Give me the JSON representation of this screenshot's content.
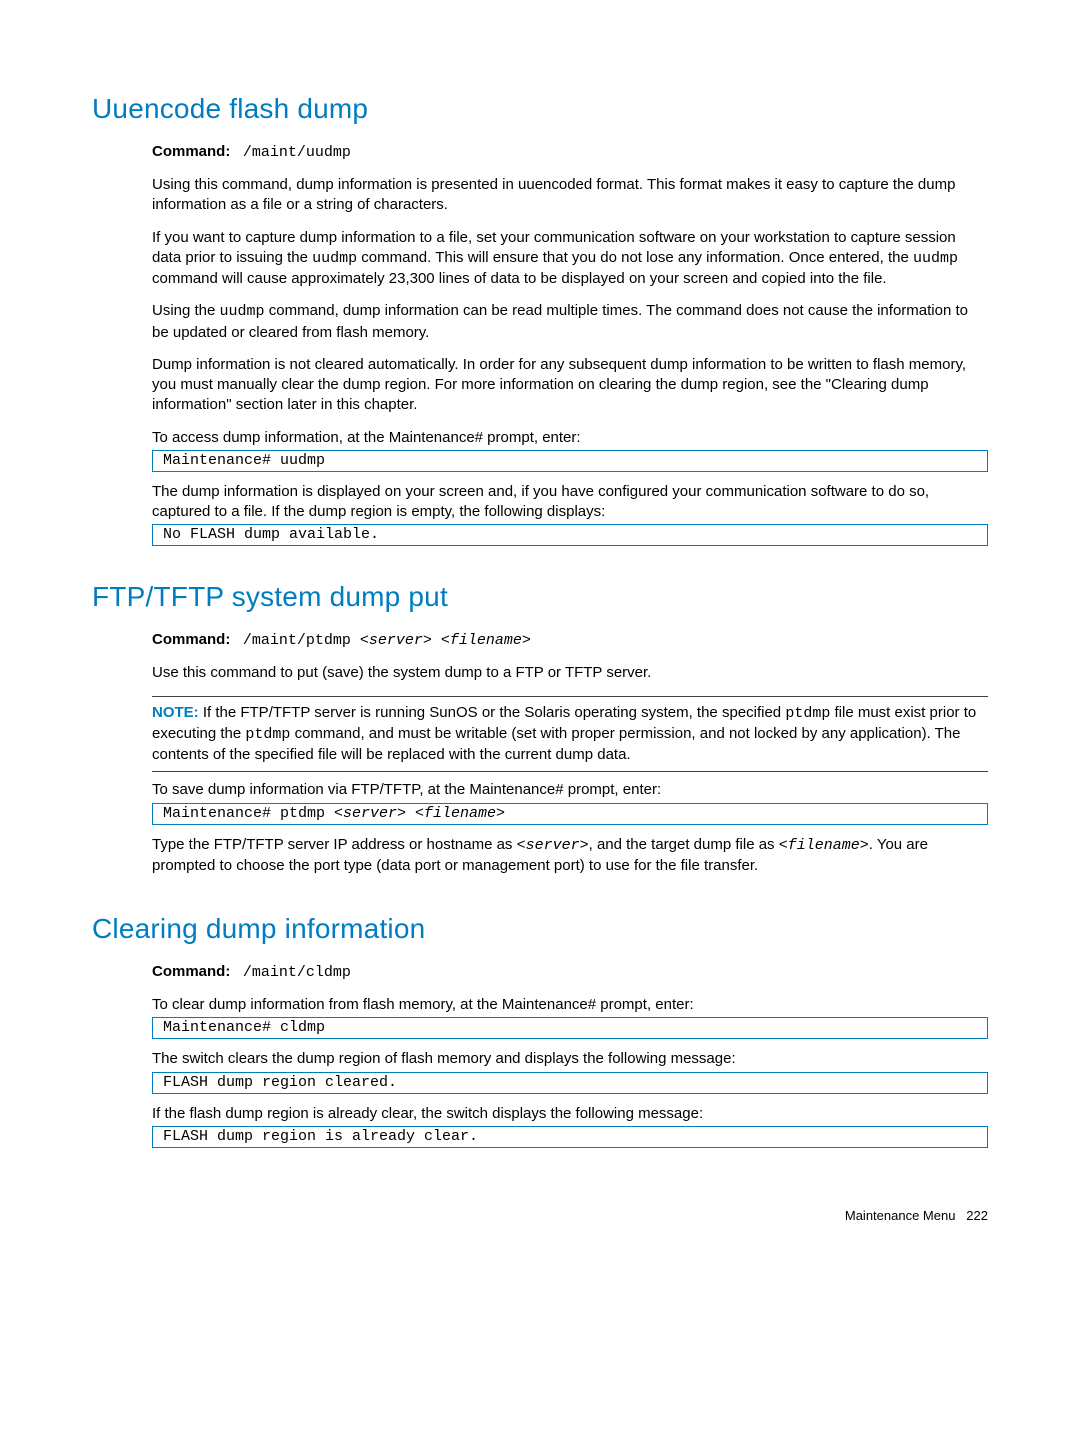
{
  "section1": {
    "heading": "Uuencode flash dump",
    "commandLabel": "Command:",
    "commandValue": "/maint/uudmp",
    "p1": "Using this command, dump information is presented in uuencoded format. This format makes it easy to capture the dump information as a file or a string of characters.",
    "p2_a": "If you want to capture dump information to a file, set your communication software on your workstation to capture session data prior to issuing the ",
    "p2_code1": "uudmp",
    "p2_b": " command. This will ensure that you do not lose any information. Once entered, the ",
    "p2_code2": "uudmp",
    "p2_c": " command will cause approximately 23,300 lines of data to be displayed on your screen and copied into the file.",
    "p3_a": "Using the ",
    "p3_code": "uudmp",
    "p3_b": " command, dump information can be read multiple times. The command does not cause the information to be updated or cleared from flash memory.",
    "p4": "Dump information is not cleared automatically. In order for any subsequent dump information to be written to flash memory, you must manually clear the dump region. For more information on clearing the dump region, see the \"Clearing dump information\" section later in this chapter.",
    "p5": "To access dump information, at the Maintenance# prompt, enter:",
    "code1": "Maintenance# uudmp",
    "p6": "The dump information is displayed on your screen and, if you have configured your communication software to do so, captured to a file. If the dump region is empty, the following displays:",
    "code2": "No FLASH dump available."
  },
  "section2": {
    "heading": "FTP/TFTP system dump put",
    "commandLabel": "Command:",
    "commandValue_a": "/maint/ptdmp ",
    "commandValue_b": "<server> <filename>",
    "p1": "Use this command to put (save) the system dump to a FTP or TFTP server.",
    "noteLabel": "NOTE:",
    "note_a": " If the FTP/TFTP server is running SunOS or the Solaris operating system, the specified ",
    "note_code1": "ptdmp",
    "note_b": " file must exist prior to executing the ",
    "note_code2": "ptdmp",
    "note_c": "  command, and must be writable (set with proper permission, and not locked by any application). The contents of the specified file will be replaced with the current dump data.",
    "p2": "To save dump information via FTP/TFTP, at the Maintenance# prompt, enter:",
    "code1_a": "Maintenance#  ptdmp ",
    "code1_b": "<server> <filename>",
    "p3_a": "Type the FTP/TFTP server IP address or hostname as ",
    "p3_code1": "<server>",
    "p3_b": ", and the target dump file as ",
    "p3_code2": "<filename>",
    "p3_c": ". You are prompted to choose the port type (data port or management port) to use for the file transfer."
  },
  "section3": {
    "heading": "Clearing dump information",
    "commandLabel": "Command:",
    "commandValue": "/maint/cldmp",
    "p1": "To clear dump information from flash memory, at the Maintenance# prompt, enter:",
    "code1": "Maintenance# cldmp",
    "p2": "The switch clears the dump region of flash memory and displays the following message:",
    "code2": "FLASH dump region cleared.",
    "p3": "If the flash dump region is already clear, the switch displays the following message:",
    "code3": "FLASH dump region is already clear."
  },
  "footer": {
    "text": "Maintenance Menu",
    "page": "222"
  }
}
